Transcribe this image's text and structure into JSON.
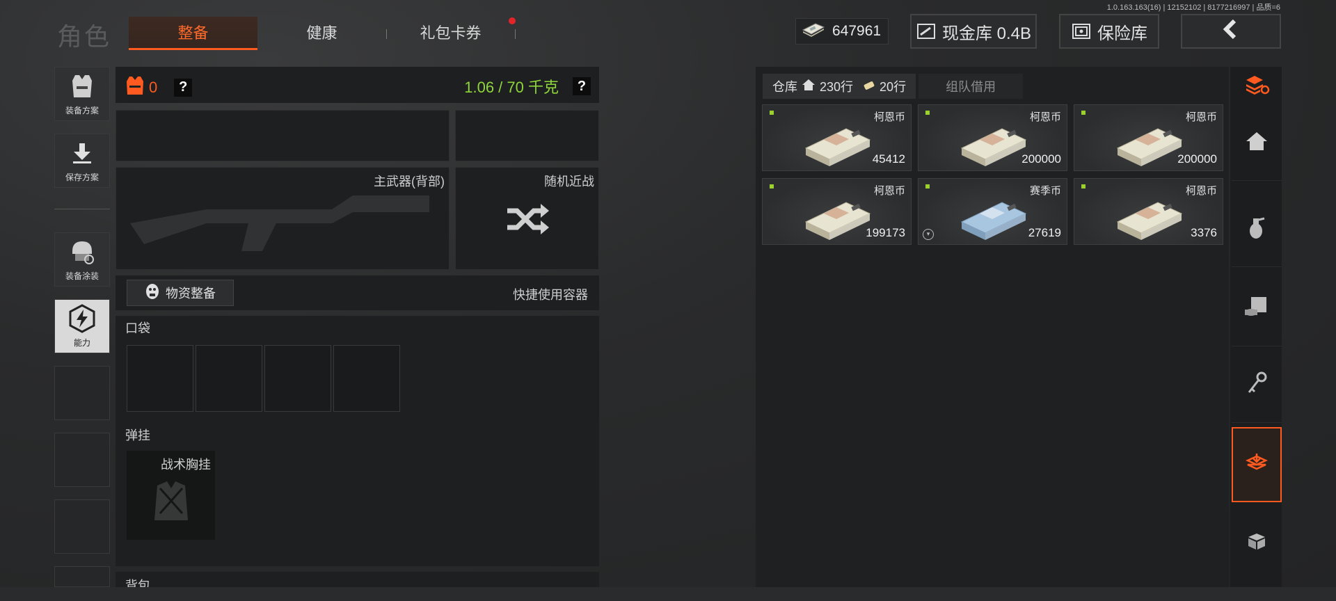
{
  "version": "1.0.163.163(16) | 12152102 | 8177216997 | 品质=6",
  "header": {
    "title": "角色",
    "tabs": [
      {
        "label": "整备",
        "active": true
      },
      {
        "label": "健康",
        "active": false
      },
      {
        "label": "礼包卡券",
        "active": false,
        "has_notification": true
      }
    ],
    "currency_amount": "647961",
    "cash_vault_label": "现金库 0.4B",
    "safe_label": "保险库",
    "back_icon": "chevron-left-icon"
  },
  "left_rail": {
    "items": [
      {
        "label": "装备方案",
        "icon": "vest-icon"
      },
      {
        "label": "保存方案",
        "icon": "download-icon"
      },
      {
        "label": "装备涂装",
        "icon": "helmet-icon"
      },
      {
        "label": "能力",
        "icon": "lightning-hex-icon",
        "active": true
      }
    ]
  },
  "loadout": {
    "armor_count": "0",
    "help": "?",
    "weight": "1.06 / 70 千克",
    "primary_weapon_label": "主武器(背部)",
    "melee_label": "随机近战",
    "supply_button": "物资整备",
    "quick_container_label": "快捷使用容器",
    "pockets_label": "口袋",
    "rig_label": "弹挂",
    "rig_slot_label": "战术胸挂",
    "backpack_label": "背包"
  },
  "stash": {
    "tab_label": "仓库",
    "rows_label": "230行",
    "extra_rows_label": "20行",
    "team_tab_label": "组队借用",
    "items": [
      {
        "name": "柯恩币",
        "amount": "45412",
        "type": "koen"
      },
      {
        "name": "柯恩币",
        "amount": "200000",
        "type": "koen"
      },
      {
        "name": "柯恩币",
        "amount": "200000",
        "type": "koen"
      },
      {
        "name": "柯恩币",
        "amount": "199173",
        "type": "koen"
      },
      {
        "name": "赛季币",
        "amount": "27619",
        "type": "season"
      },
      {
        "name": "柯恩币",
        "amount": "3376",
        "type": "koen"
      }
    ]
  },
  "right_rail": {
    "items": [
      {
        "icon": "stack-refresh-icon"
      },
      {
        "icon": "home-icon"
      },
      {
        "icon": "grenade-icon"
      },
      {
        "icon": "ammo-icon"
      },
      {
        "icon": "key-icon"
      },
      {
        "icon": "loot-icon",
        "active": true
      },
      {
        "icon": "box-icon"
      }
    ]
  },
  "colors": {
    "accent": "#ff5a1f",
    "weight_green": "#8fd63b",
    "notify_red": "#e3252a"
  }
}
